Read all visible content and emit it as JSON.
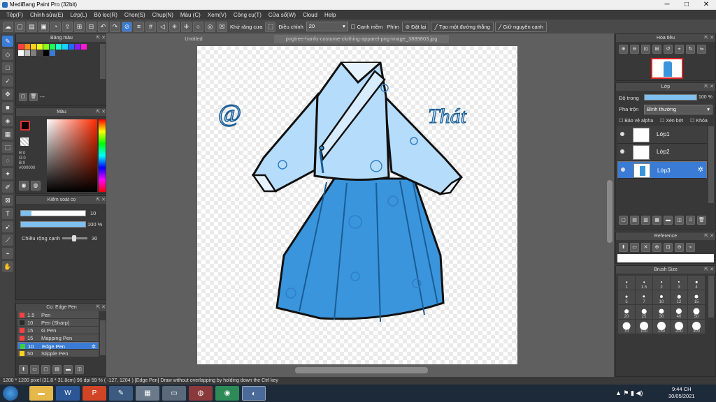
{
  "app": {
    "title": "MediBang Paint Pro (32bit)"
  },
  "window_controls": {
    "minimize": "─",
    "maximize": "□",
    "close": "✕"
  },
  "menu": [
    "Tệp(F)",
    "Chỉnh sửa(E)",
    "Lớp(L)",
    "Bộ lọc(R)",
    "Chọn(S)",
    "Chụp(N)",
    "Màu (C)",
    "Xem(V)",
    "Công cụ(T)",
    "Cửa sổ(W)",
    "Cloud",
    "Help"
  ],
  "toolbar": {
    "antialias_label": "Khử răng cưa",
    "correction_label": "Điều chỉnh",
    "correction_value": "20",
    "snap_label": "Canh mềm",
    "key_label": "Phím",
    "reset_button": "Đặt lại",
    "straight_button": "Tạo một đường thẳng",
    "keep_edge_button": "Giữ nguyên cạnh"
  },
  "panels": {
    "palette_title": "Bảng màu",
    "palette_name": "---",
    "palette_colors": [
      "#ff4040",
      "#ff8c1a",
      "#ffd21a",
      "#e8ff1a",
      "#8cff1a",
      "#1aff5a",
      "#1affd2",
      "#1ad2ff",
      "#1a6eff",
      "#8c1aff",
      "#ff1ad2",
      "#ffffff",
      "#bfbfbf",
      "#7f7f7f",
      "#3f3f3f",
      "#000000",
      "#3a7bd5"
    ],
    "color_title": "Màu",
    "color_readout": [
      "R:0",
      "G:0",
      "B:0",
      "#000000"
    ],
    "brush_control_title": "Kiểm soát cọ",
    "brush_size": "10",
    "opacity": "100 %",
    "edge_width_label": "Chiều rộng cạnh",
    "edge_width_value": "30",
    "brush_list_title": "Cọ: Edge Pen",
    "brushes": [
      {
        "size": "1.5",
        "name": "Pen",
        "color": "#ff4040"
      },
      {
        "size": "10",
        "name": "Pen (Sharp)",
        "color": "#2a2a2a"
      },
      {
        "size": "15",
        "name": "G Pen",
        "color": "#ff4040"
      },
      {
        "size": "15",
        "name": "Mapping Pen",
        "color": "#ff4040"
      },
      {
        "size": "10",
        "name": "Edge Pen",
        "color": "#3ecf3e",
        "selected": true
      },
      {
        "size": "50",
        "name": "Stipple Pen",
        "color": "#ffd21a"
      }
    ]
  },
  "canvas": {
    "tab_untitled": "Untitled",
    "tab_file": "pngtree-hanfu-costume-clothing-apparel-png-image_3889803.jpg",
    "text_left": "@",
    "text_right": "Thát"
  },
  "right": {
    "navigator_title": "Hoa tiêu",
    "layer_title": "Lớp",
    "opacity_label": "Độ trong",
    "opacity_value": "100 %",
    "opacity_fraction": 1.0,
    "blend_label": "Pha trộn",
    "blend_value": "Bình thường",
    "protect_alpha": "Bảo vệ alpha",
    "clipping": "Xén bớt",
    "lock": "Khóa",
    "layers": [
      {
        "name": "Lớp1",
        "selected": false
      },
      {
        "name": "Lớp2",
        "selected": false
      },
      {
        "name": "Lớp3",
        "selected": true
      }
    ],
    "reference_title": "Reference",
    "brush_size_title": "Brush Size",
    "brush_sizes": [
      "1",
      "1.5",
      "2",
      "3",
      "4",
      "5",
      "7",
      "10",
      "12",
      "15",
      "20",
      "25",
      "30",
      "40",
      "50",
      "70",
      "100",
      "150",
      "200",
      "300"
    ]
  },
  "status": {
    "size": "1200 * 1200 pixel",
    "physical": "(31.8 * 31.8cm)",
    "dpi": "96 dpi",
    "zoom": "59 %",
    "coords": "( -127, 1204 )",
    "hint": "[Edge Pen] Draw without overlapping by holding down the Ctrl key"
  },
  "taskbar": {
    "clock_time": "9:44 CH",
    "clock_date": "30/05/2021"
  },
  "colors": {
    "accent": "#3a7bd5",
    "shirt": "#b6dcfb",
    "skirt": "#3a95dc"
  }
}
